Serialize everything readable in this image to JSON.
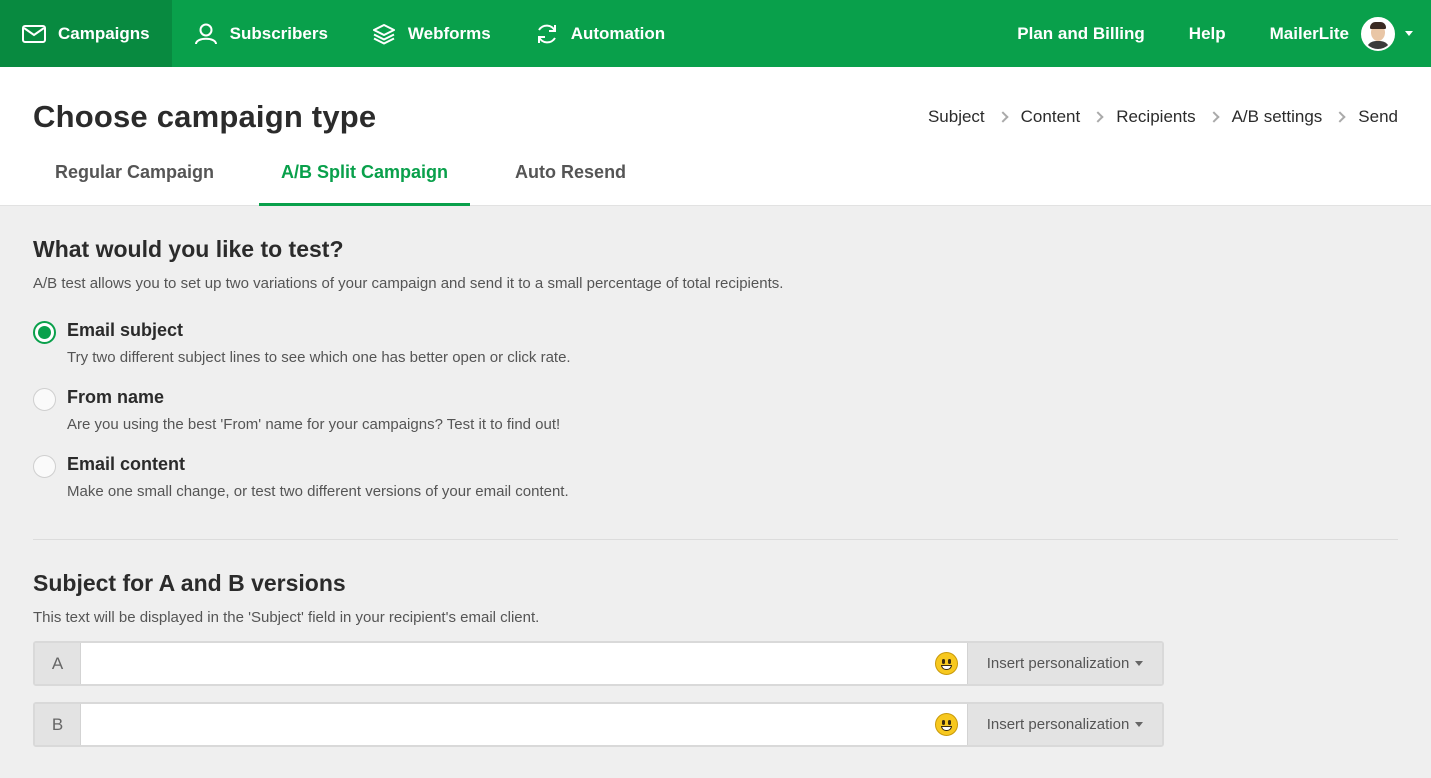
{
  "nav": {
    "items": [
      {
        "label": "Campaigns",
        "icon": "envelope-icon",
        "active": true
      },
      {
        "label": "Subscribers",
        "icon": "user-icon",
        "active": false
      },
      {
        "label": "Webforms",
        "icon": "layers-icon",
        "active": false
      },
      {
        "label": "Automation",
        "icon": "refresh-icon",
        "active": false
      }
    ],
    "plan_billing": "Plan and Billing",
    "help": "Help",
    "account_name": "MailerLite"
  },
  "header": {
    "title": "Choose campaign type",
    "steps": [
      "Subject",
      "Content",
      "Recipients",
      "A/B settings",
      "Send"
    ],
    "tabs": [
      {
        "label": "Regular Campaign",
        "active": false
      },
      {
        "label": "A/B Split Campaign",
        "active": true
      },
      {
        "label": "Auto Resend",
        "active": false
      }
    ]
  },
  "test_section": {
    "title": "What would you like to test?",
    "description": "A/B test allows you to set up two variations of your campaign and send it to a small percentage of total recipients.",
    "options": [
      {
        "title": "Email subject",
        "description": "Try two different subject lines to see which one has better open or click rate.",
        "selected": true
      },
      {
        "title": "From name",
        "description": "Are you using the best 'From' name for your campaigns? Test it to find out!",
        "selected": false
      },
      {
        "title": "Email content",
        "description": "Make one small change, or test two different versions of your email content.",
        "selected": false
      }
    ]
  },
  "subject_section": {
    "title": "Subject for A and B versions",
    "description": "This text will be displayed in the 'Subject' field in your recipient's email client.",
    "rows": [
      {
        "label": "A",
        "value": "",
        "personalize": "Insert personalization"
      },
      {
        "label": "B",
        "value": "",
        "personalize": "Insert personalization"
      }
    ]
  },
  "colors": {
    "brand_green": "#09a04b",
    "active_nav": "#088a40"
  }
}
